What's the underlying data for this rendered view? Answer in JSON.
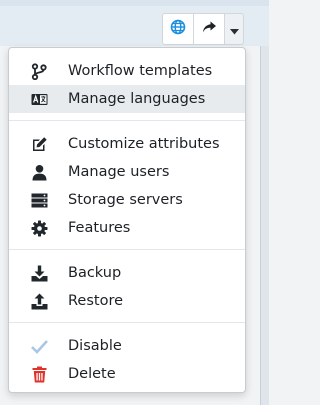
{
  "toolbar": {
    "globe_icon": "globe-icon",
    "share_icon": "share-icon",
    "caret_icon": "caret-down-icon",
    "accent": "#1b8ee0"
  },
  "menu": {
    "items": [
      {
        "label": "Workflow templates",
        "icon": "workflow-icon"
      },
      {
        "label": "Manage languages",
        "icon": "language-icon"
      },
      {
        "label": "Customize attributes",
        "icon": "edit-icon"
      },
      {
        "label": "Manage users",
        "icon": "user-icon"
      },
      {
        "label": "Storage servers",
        "icon": "server-icon"
      },
      {
        "label": "Features",
        "icon": "gear-icon"
      },
      {
        "label": "Backup",
        "icon": "download-icon"
      },
      {
        "label": "Restore",
        "icon": "upload-icon"
      },
      {
        "label": "Disable",
        "icon": "check-icon"
      },
      {
        "label": "Delete",
        "icon": "trash-icon"
      }
    ],
    "highlighted_item": "Manage languages",
    "colors": {
      "icon": "#22272c",
      "check": "#a9c7e3",
      "delete": "#e0332b"
    }
  }
}
